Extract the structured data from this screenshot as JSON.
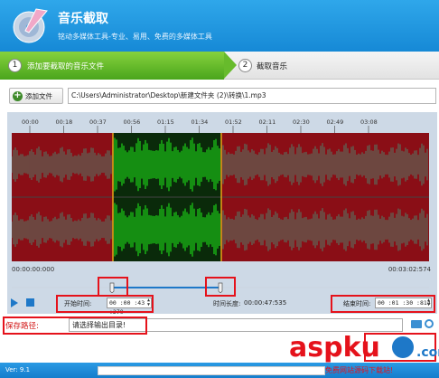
{
  "app": {
    "title": "音乐截取",
    "subtitle": "铭动多媒体工具-专业、易用、免费的多媒体工具"
  },
  "steps": [
    {
      "num": "1",
      "label": "添加要截取的音乐文件",
      "active": true
    },
    {
      "num": "2",
      "label": "截取音乐",
      "active": false
    }
  ],
  "toolbar": {
    "add_label": "添加文件",
    "file_path": "C:\\Users\\Administrator\\Desktop\\新建文件夹 (2)\\转换\\1.mp3"
  },
  "ruler": {
    "ticks": [
      "00:00",
      "00:18",
      "00:37",
      "00:56",
      "01:15",
      "01:34",
      "01:52",
      "02:11",
      "02:30",
      "02:49",
      "03:08"
    ]
  },
  "timeline": {
    "start": "00:00:00:000",
    "end": "00:03:02:574"
  },
  "controls": {
    "start_label": "开始时间:",
    "start_value": "00 :00 :43 :270",
    "length_label": "时间长度:",
    "length_value": "00:00:47:535",
    "end_label": "结束时间:",
    "end_value": "00 :01 :30 :814"
  },
  "save": {
    "label": "保存路径:",
    "placeholder": "请选择输出目录!"
  },
  "footer": {
    "version": "Ver: 9.1"
  },
  "watermark": {
    "brand": "aspku",
    "tld": ".com",
    "tagline": "免费网站源码下载站!"
  },
  "colors": {
    "header": "#1e90dd",
    "wave_bg": "#8a0e16",
    "wave_sel_bg": "#0a2a0a",
    "wave_sel": "#1dd117",
    "wave_out": "#5a6d5d",
    "marker": "#e8a317",
    "highlight": "#e5121b"
  }
}
